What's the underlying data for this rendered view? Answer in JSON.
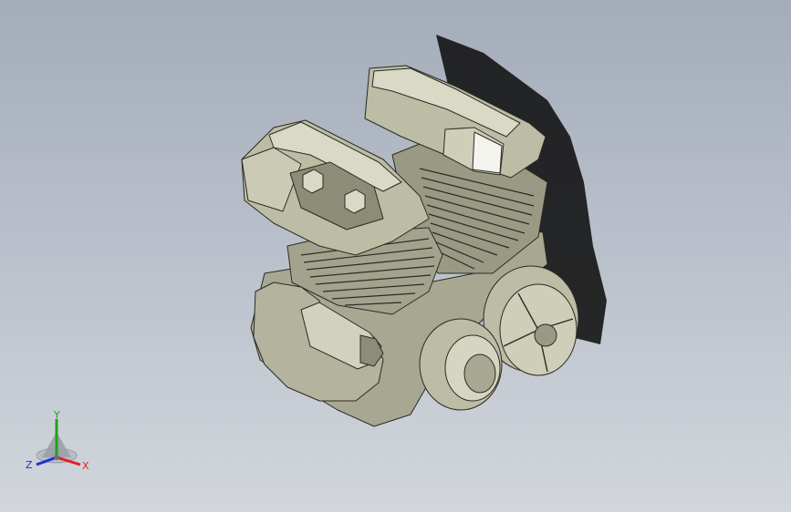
{
  "viewport": {
    "background_top": "#a4acba",
    "background_bottom": "#d2d6dc"
  },
  "model": {
    "part_color": "#bdbca5",
    "part_shadow": "#8d8c76",
    "part_highlight": "#dad9c6",
    "edge_color": "#2b2b24",
    "ground_shadow": "#141414"
  },
  "triad": {
    "x_label": "X",
    "y_label": "Y",
    "z_label": "Z",
    "x_color": "#e02020",
    "y_color": "#20a020",
    "z_color": "#2030d0"
  }
}
